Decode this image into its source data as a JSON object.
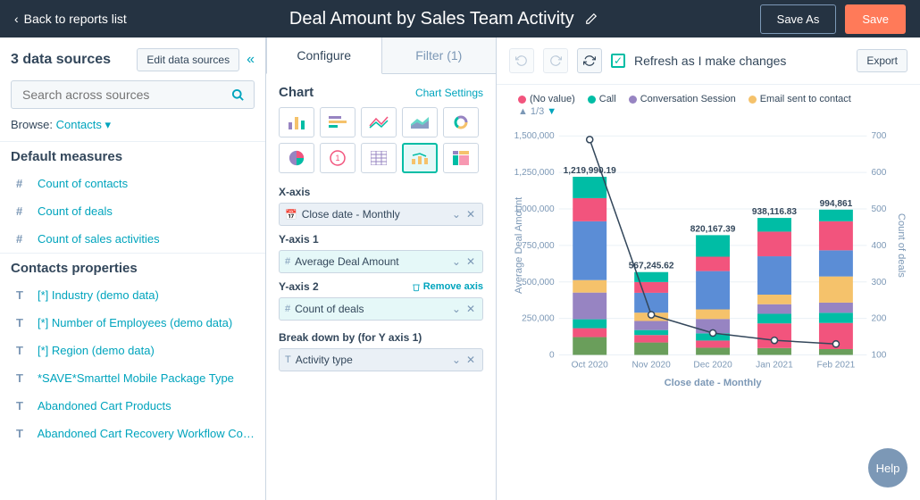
{
  "header": {
    "back": "Back to reports list",
    "title": "Deal Amount by Sales Team Activity",
    "save_as": "Save As",
    "save": "Save"
  },
  "left": {
    "sources_title": "3 data sources",
    "edit_sources": "Edit data sources",
    "search_placeholder": "Search across sources",
    "browse_label": "Browse:",
    "browse_value": "Contacts",
    "measures_title": "Default measures",
    "measures": [
      "Count of contacts",
      "Count of deals",
      "Count of sales activities"
    ],
    "props_title": "Contacts properties",
    "props": [
      "[*] Industry (demo data)",
      "[*] Number of Employees (demo data)",
      "[*] Region (demo data)",
      "*SAVE*Smarttel Mobile Package Type",
      "Abandoned Cart Products",
      "Abandoned Cart Recovery Workflow Con…"
    ]
  },
  "mid": {
    "tab_configure": "Configure",
    "tab_filter": "Filter (1)",
    "chart_heading": "Chart",
    "chart_settings": "Chart Settings",
    "x_label": "X-axis",
    "x_value": "Close date - Monthly",
    "y1_label": "Y-axis 1",
    "y1_value": "Average Deal Amount",
    "y2_label": "Y-axis 2",
    "y2_remove": "Remove axis",
    "y2_value": "Count of deals",
    "breakdown_label": "Break down by (for Y axis 1)",
    "breakdown_value": "Activity type"
  },
  "right": {
    "refresh_label": "Refresh as I make changes",
    "export": "Export",
    "pager": "1/3",
    "legend": [
      {
        "label": "(No value)",
        "color": "#f2547d"
      },
      {
        "label": "Call",
        "color": "#00bda5"
      },
      {
        "label": "Conversation Session",
        "color": "#9784c2"
      },
      {
        "label": "Email sent to contact",
        "color": "#f5c26b"
      }
    ]
  },
  "chart_data": {
    "type": "bar",
    "title": "",
    "xlabel": "Close date - Monthly",
    "ylabel": "Average Deal Amount",
    "ylabel2": "Count of deals",
    "ylim": [
      0,
      1500000
    ],
    "ylim2": [
      100,
      700
    ],
    "categories": [
      "Oct 2020",
      "Nov 2020",
      "Dec 2020",
      "Jan 2021",
      "Feb 2021"
    ],
    "totals": [
      1219990.19,
      567245.62,
      820167.39,
      938116.83,
      994861
    ],
    "count_of_deals": [
      690,
      210,
      160,
      140,
      130
    ],
    "stack_colors": [
      "#6a9e5b",
      "#f2547d",
      "#00bda5",
      "#9784c2",
      "#f5c26b",
      "#5b8dd6",
      "#f2547d",
      "#00bda5"
    ],
    "stacks": [
      [
        0.1,
        0.05,
        0.05,
        0.15,
        0.07,
        0.33,
        0.13,
        0.12
      ],
      [
        0.15,
        0.09,
        0.06,
        0.11,
        0.1,
        0.24,
        0.13,
        0.12
      ],
      [
        0.06,
        0.06,
        0.06,
        0.12,
        0.08,
        0.32,
        0.12,
        0.18
      ],
      [
        0.05,
        0.18,
        0.07,
        0.07,
        0.07,
        0.28,
        0.18,
        0.1
      ],
      [
        0.04,
        0.18,
        0.07,
        0.07,
        0.18,
        0.18,
        0.2,
        0.08
      ]
    ]
  },
  "help": "Help"
}
